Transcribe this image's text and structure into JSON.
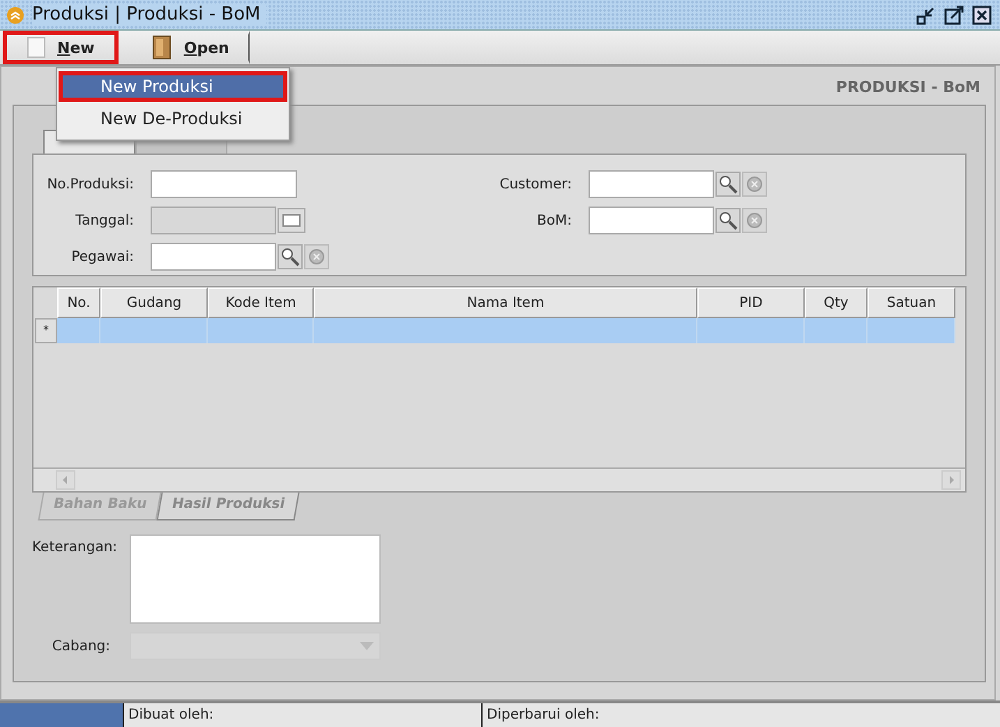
{
  "window": {
    "title": "Produksi | Produksi - BoM"
  },
  "toolbar": [
    {
      "label": "New",
      "kind": "new",
      "highlighted": true
    },
    {
      "label": "Open",
      "kind": "open",
      "highlighted": false
    }
  ],
  "new_menu": [
    {
      "label": "New Produksi",
      "selected": true
    },
    {
      "label": "New De-Produksi",
      "selected": false
    }
  ],
  "header": "PRODUKSI - BoM",
  "top_tabs": [
    {
      "selected": true
    },
    {
      "selected": false
    }
  ],
  "form": {
    "left": [
      {
        "label": "No.Produksi:",
        "kind": "text",
        "disabled": false
      },
      {
        "label": "Tanggal:",
        "kind": "date",
        "disabled": true
      },
      {
        "label": "Pegawai:",
        "kind": "lookup",
        "disabled": false
      }
    ],
    "right": [
      {
        "label": "Customer:",
        "kind": "lookup",
        "disabled": false
      },
      {
        "label": "BoM:",
        "kind": "lookup",
        "disabled": false
      }
    ]
  },
  "grid": {
    "columns": [
      "No.",
      "Gudang",
      "Kode Item",
      "Nama Item",
      "PID",
      "Qty",
      "Satuan"
    ],
    "rows": [
      {
        "marker": "*",
        "selected": true
      }
    ]
  },
  "bottom_tabs": [
    {
      "label": "Bahan Baku",
      "selected": false
    },
    {
      "label": "Hasil Produksi",
      "selected": true
    }
  ],
  "keterangan": {
    "label": "Keterangan:"
  },
  "cabang": {
    "label": "Cabang:",
    "disabled": true
  },
  "status_bar": [
    "Dibuat oleh:",
    "Diperbarui oleh:"
  ]
}
